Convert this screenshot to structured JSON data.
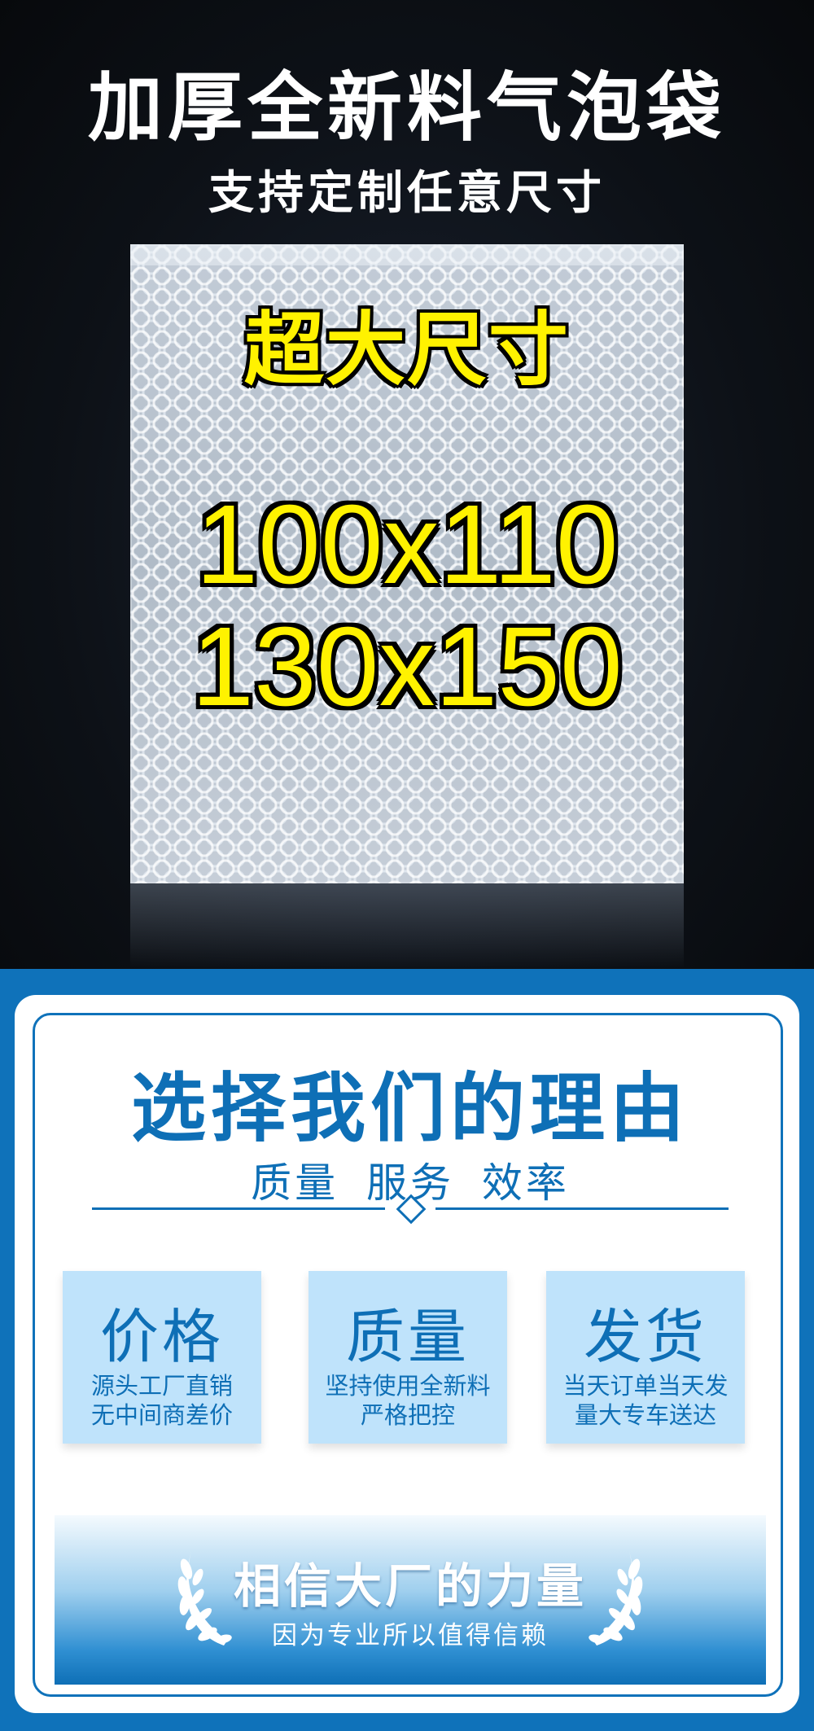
{
  "header": {
    "title": "加厚全新料气泡袋",
    "subtitle": "支持定制任意尺寸"
  },
  "product": {
    "badge": "超大尺寸",
    "sizes": [
      "100x110",
      "130x150"
    ],
    "text_color": "#fff200"
  },
  "reasons": {
    "title": "选择我们的理由",
    "subtitle": "质量  服务  效率",
    "accent_color": "#0e6fb6",
    "features": [
      {
        "title": "价格",
        "lines": [
          "源头工厂直销",
          "无中间商差价"
        ]
      },
      {
        "title": "质量",
        "lines": [
          "坚持使用全新料",
          "严格把控"
        ]
      },
      {
        "title": "发货",
        "lines": [
          "当天订单当天发",
          "量大专车送达"
        ]
      }
    ]
  },
  "banner": {
    "title": "相信大厂的力量",
    "subtitle": "因为专业所以值得信赖",
    "icon": "laurel-wreath-icon"
  }
}
